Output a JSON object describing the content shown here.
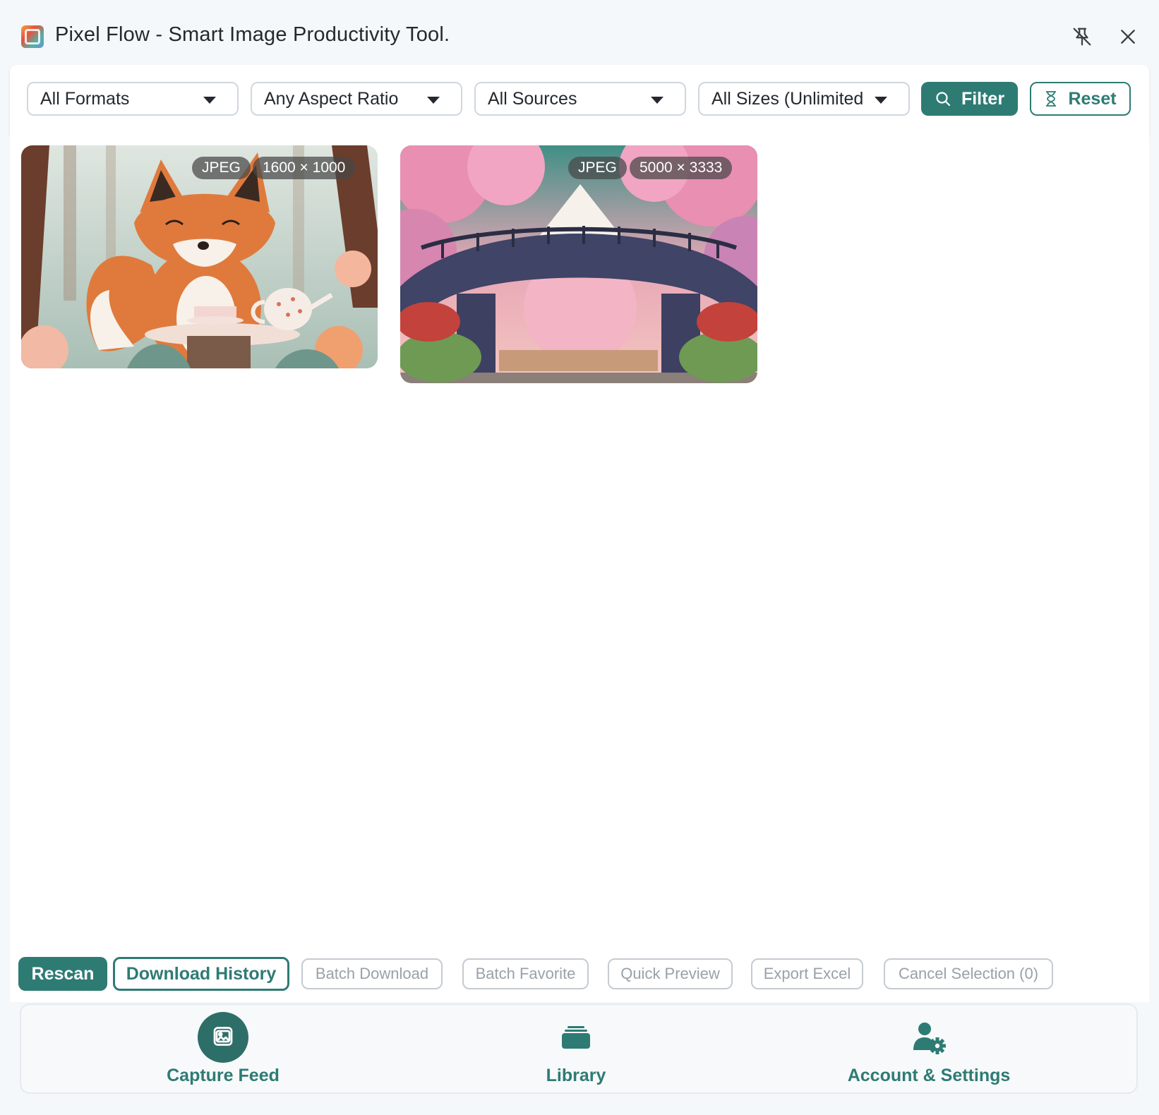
{
  "app": {
    "title": "Pixel Flow - Smart Image Productivity Tool."
  },
  "colors": {
    "accent": "#2e7b74",
    "disabled": "#9aa1a8"
  },
  "filters": {
    "format": "All Formats",
    "aspect_ratio": "Any Aspect Ratio",
    "source": "All Sources",
    "size": "All Sizes (Unlimited",
    "filter_label": "Filter",
    "reset_label": "Reset"
  },
  "images": [
    {
      "format": "JPEG",
      "dimensions": "1600 × 1000",
      "subject": "fox-tea-illustration"
    },
    {
      "format": "JPEG",
      "dimensions": "5000 × 3333",
      "subject": "cherry-blossom-bridge-illustration"
    }
  ],
  "actions": {
    "rescan": "Rescan",
    "download_history": "Download History",
    "batch_download": "Batch Download",
    "batch_favorite": "Batch Favorite",
    "quick_preview": "Quick Preview",
    "export_excel": "Export Excel",
    "cancel_selection": "Cancel Selection (0)"
  },
  "nav": {
    "capture_feed": "Capture Feed",
    "library": "Library",
    "account_settings": "Account & Settings",
    "active": "capture_feed"
  },
  "icons": {
    "pin": "unpin-icon",
    "close": "close-icon",
    "filter": "search-icon",
    "reset": "hourglass-icon",
    "capture": "image-icon",
    "library": "stack-icon",
    "account": "user-gear-icon"
  }
}
